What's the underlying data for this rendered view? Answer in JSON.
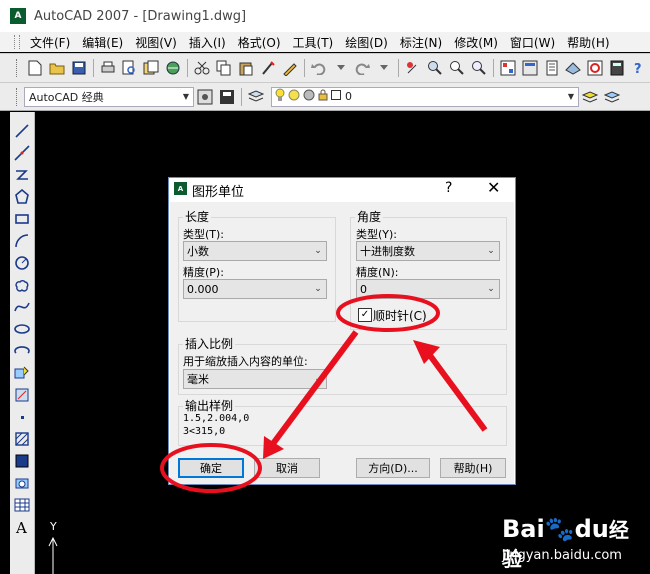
{
  "window": {
    "app_logo_text": "A",
    "title": "AutoCAD 2007 - [Drawing1.dwg]"
  },
  "menu": [
    "文件(F)",
    "编辑(E)",
    "视图(V)",
    "插入(I)",
    "格式(O)",
    "工具(T)",
    "绘图(D)",
    "标注(N)",
    "修改(M)",
    "窗口(W)",
    "帮助(H)"
  ],
  "toolbar2": {
    "workspace": "AutoCAD 经典",
    "layer_value": "0"
  },
  "dialog": {
    "logo_text": "A",
    "title": "图形单位",
    "help": "?",
    "close": "✕",
    "length": {
      "group": "长度",
      "type_label": "类型(T):",
      "type_value": "小数",
      "precision_label": "精度(P):",
      "precision_value": "0.000"
    },
    "angle": {
      "group": "角度",
      "type_label": "类型(Y):",
      "type_value": "十进制度数",
      "precision_label": "精度(N):",
      "precision_value": "0",
      "clockwise_label": "顺时针(C)",
      "clockwise_checked": true
    },
    "insert": {
      "group": "插入比例",
      "label": "用于缩放插入内容的单位:",
      "value": "毫米"
    },
    "sample": {
      "group": "输出样例",
      "line1": "1.5,2.004,0",
      "line2": "3<315,0"
    },
    "buttons": {
      "ok": "确定",
      "cancel": "取消",
      "direction": "方向(D)...",
      "help": "帮助(H)"
    }
  },
  "ucs": {
    "y_label": "Y"
  },
  "watermark": {
    "brand_a": "Bai",
    "brand_paw": "🐾",
    "brand_b": "du",
    "brand_cn": "经验",
    "url": "jingyan.baidu.com"
  },
  "colors": {
    "annotation": "#e8101e",
    "canvas": "#000000",
    "accent": "#0078d7"
  }
}
